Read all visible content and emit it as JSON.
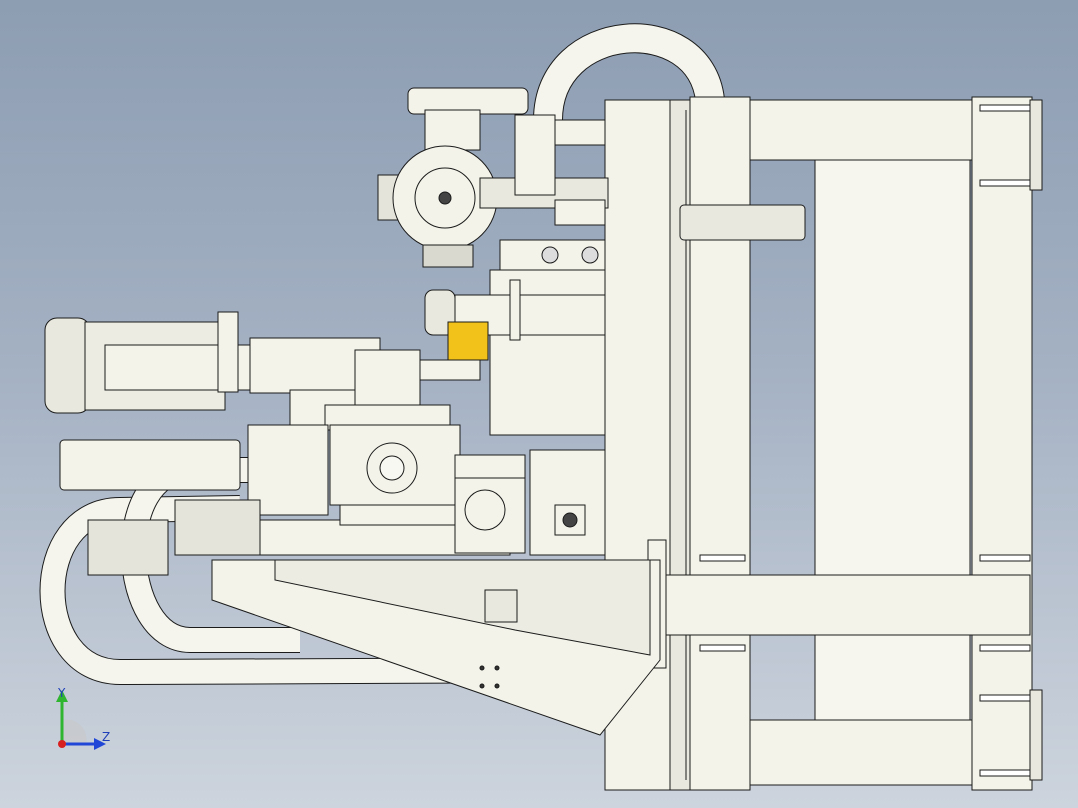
{
  "triad": {
    "y_label": "Y",
    "z_label": "Z",
    "colors": {
      "y": "#2fb52f",
      "z": "#2046d8",
      "x": "#d82020"
    }
  },
  "model_colors": {
    "body": "#f3f3ea",
    "shade": "#d9d9cf",
    "line": "#1b1b1b",
    "accent": "#f2c21b",
    "dark": "#333333"
  }
}
